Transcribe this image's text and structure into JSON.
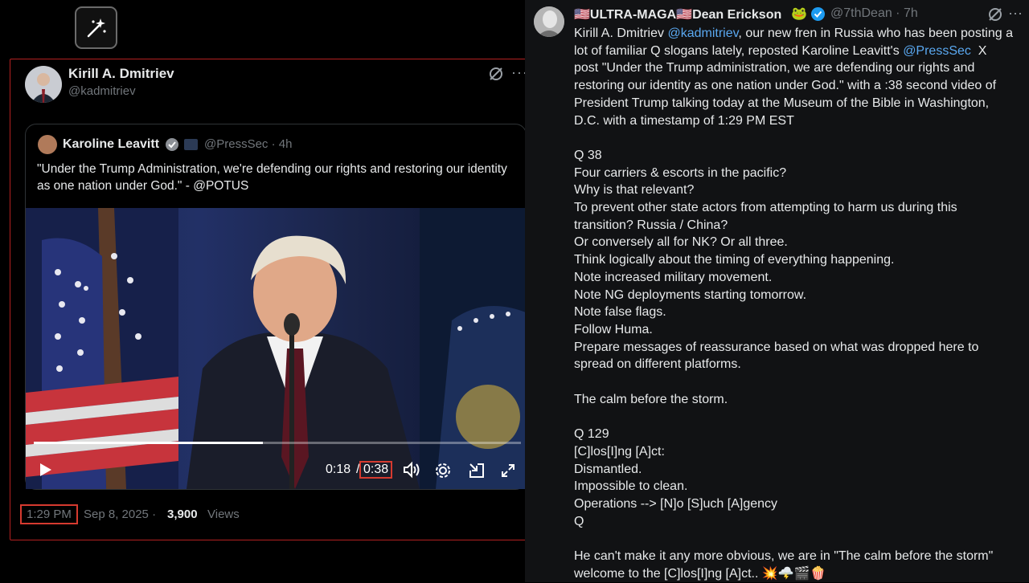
{
  "left_tweet": {
    "author_name": "Kirill A. Dmitriev",
    "author_handle": "@kadmitriev",
    "quoted": {
      "author_name": "Karoline Leavitt",
      "author_handle": "@PressSec · 4h",
      "text": "\"Under the Trump Administration, we're defending our rights and restoring our identity as one nation under God.\" - @POTUS"
    },
    "video": {
      "current_time": "0:18",
      "separator": "/",
      "total_time": "0:38",
      "progress_fraction": 0.47
    },
    "posted_time": "1:29 PM",
    "posted_date": "Sep 8, 2025 ·",
    "views_count": "3,900",
    "views_label": "Views"
  },
  "right_tweet": {
    "author_name": "🇺🇸ULTRA-MAGA🇺🇸Dean Erickson",
    "author_emoji": "🐸",
    "author_handle": "@7thDean · 7h",
    "body_intro_1": "Kirill A. Dmitriev ",
    "mention_1": "@kadmitriev",
    "body_intro_2": ", our new fren in Russia who has been posting a lot of familiar Q slogans lately, reposted Karoline Leavitt's ",
    "mention_2": "@PressSec",
    "body_intro_3": "  X post \"Under the Trump administration, we are defending our rights and restoring our identity as one nation under God.\" with a :38 second video of President Trump talking today at the Museum of the Bible in Washington, D.C. with a timestamp of 1:29 PM EST",
    "body_rest": "\n\nQ 38\nFour carriers & escorts in the pacific?\nWhy is that relevant?\nTo prevent other state actors from attempting to harm us during this transition? Russia / China?\nOr conversely all for NK? Or all three.\nThink logically about the timing of everything happening.\nNote increased military movement.\nNote NG deployments starting tomorrow.\nNote false flags.\nFollow Huma.\nPrepare messages of reassurance based on what was dropped here to spread on different platforms.\n\nThe calm before the storm.\n\nQ 129\n[C]los[I]ng [A]ct:\nDismantled.\nImpossible to clean.\nOperations --> [N]o [S]uch [A]gency\nQ\n\nHe can't make it any more obvious, we are in \"The calm before the storm\" welcome to the [C]los[I]ng [A]ct.. 💥🌩️🎬🍿"
  },
  "colors": {
    "highlight_red": "#d63a2f",
    "link_blue": "#5aa8f0",
    "verified_blue": "#1d9bf0"
  },
  "icons": [
    "sparkle-icon",
    "grok-icon",
    "more-icon",
    "verified-icon",
    "play-icon",
    "volume-icon",
    "settings-icon",
    "pip-icon",
    "fullscreen-icon"
  ]
}
